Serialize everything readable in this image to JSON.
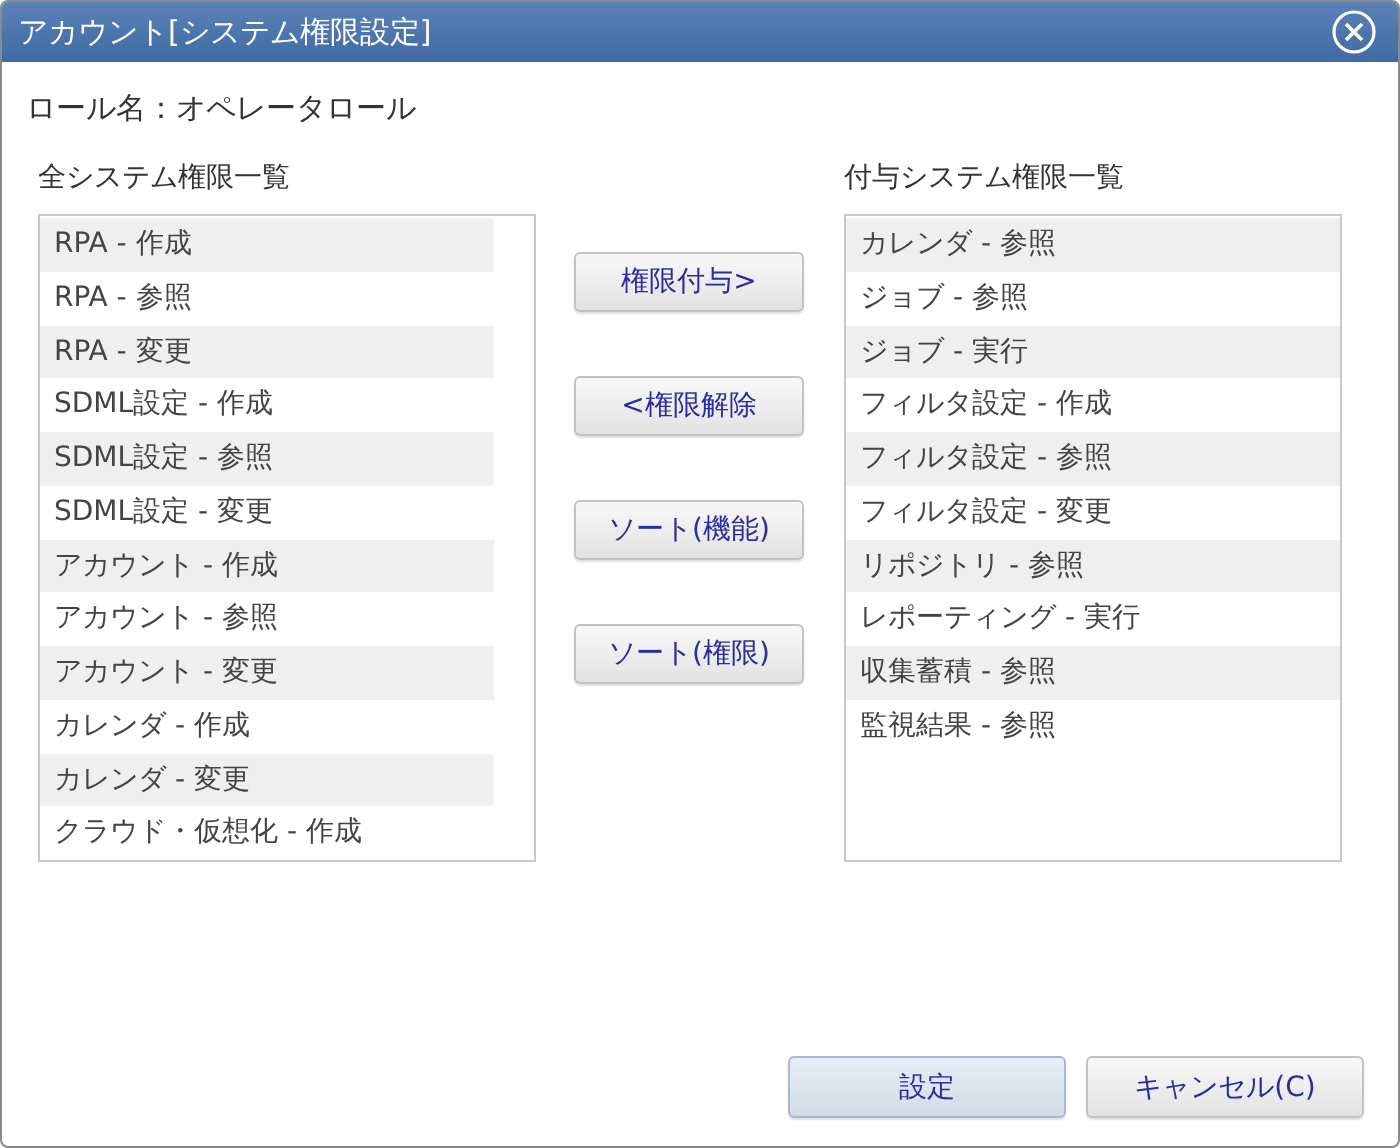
{
  "window": {
    "title": "アカウント[システム権限設定]"
  },
  "role": {
    "label": "ロール名：オペレータロール"
  },
  "available": {
    "heading": "全システム権限一覧",
    "items": [
      {
        "label": "RPA - 作成"
      },
      {
        "label": "RPA - 参照"
      },
      {
        "label": "RPA - 変更"
      },
      {
        "label": "SDML設定 - 作成"
      },
      {
        "label": "SDML設定 - 参照"
      },
      {
        "label": "SDML設定 - 変更"
      },
      {
        "label": "アカウント - 作成"
      },
      {
        "label": "アカウント - 参照"
      },
      {
        "label": "アカウント - 変更"
      },
      {
        "label": "カレンダ - 作成"
      },
      {
        "label": "カレンダ - 変更"
      },
      {
        "label": "クラウド・仮想化 - 作成"
      }
    ]
  },
  "actions": [
    "権限付与>",
    "<権限解除",
    "ソート(機能)",
    "ソート(権限)"
  ],
  "granted": {
    "heading": "付与システム権限一覧",
    "items": [
      {
        "label": "カレンダ - 参照"
      },
      {
        "label": "ジョブ - 参照"
      },
      {
        "label": "ジョブ - 実行"
      },
      {
        "label": "フィルタ設定 - 作成"
      },
      {
        "label": "フィルタ設定 - 参照"
      },
      {
        "label": "フィルタ設定 - 変更"
      },
      {
        "label": "リポジトリ - 参照"
      },
      {
        "label": "レポーティング - 実行"
      },
      {
        "label": "収集蓄積 - 参照"
      },
      {
        "label": "監視結果 - 参照"
      }
    ]
  },
  "footer_buttons": [
    {
      "label": "設定",
      "default": true
    },
    {
      "label": "キャンセル(C)",
      "default": false
    }
  ]
}
